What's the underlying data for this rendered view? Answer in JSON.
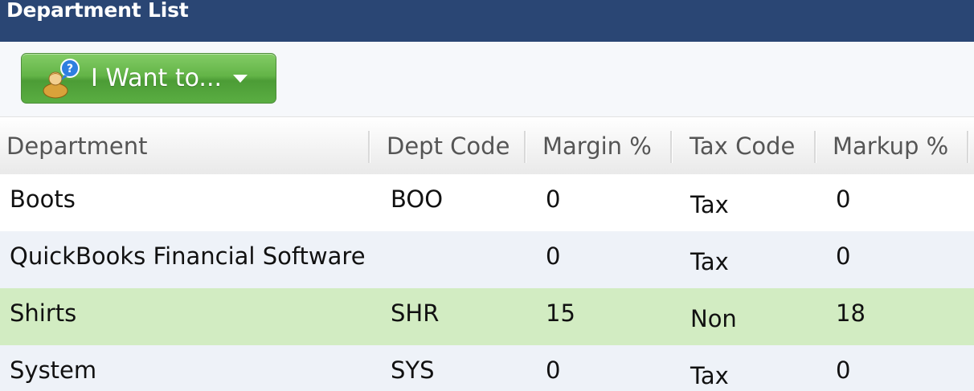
{
  "window": {
    "title": "Department List"
  },
  "toolbar": {
    "want_button_label": "I Want to...",
    "want_button_icon": "person-help-icon",
    "accent_color": "#5aae42"
  },
  "table": {
    "columns": [
      "Department",
      "Dept Code",
      "Margin %",
      "Tax Code",
      "Markup %"
    ],
    "rows": [
      {
        "department": "Boots",
        "dept_code": "BOO",
        "margin": "0",
        "tax_code": "Tax",
        "markup": "0"
      },
      {
        "department": "QuickBooks Financial Software",
        "dept_code": "",
        "margin": "0",
        "tax_code": "Tax",
        "markup": "0"
      },
      {
        "department": "Shirts",
        "dept_code": "SHR",
        "margin": "15",
        "tax_code": "Non",
        "markup": "18"
      },
      {
        "department": "System",
        "dept_code": "SYS",
        "margin": "0",
        "tax_code": "Tax",
        "markup": "0"
      }
    ],
    "selected_row_color": "#d2ecc2",
    "alt_row_color": "#eef2f8"
  },
  "colors": {
    "title_bar": "#2a4674"
  }
}
